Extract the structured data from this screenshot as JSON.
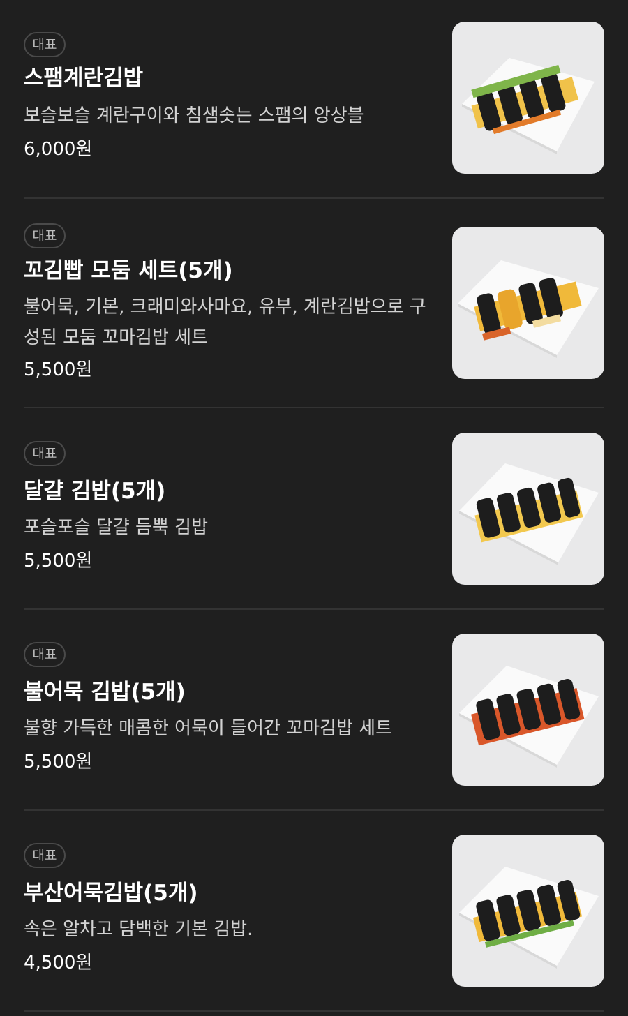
{
  "menu": {
    "items": [
      {
        "badge": "대표",
        "name": "스팸계란김밥",
        "desc": "보슬보슬 계란구이와 침샘솟는 스팸의 앙상블",
        "price": "6,000원",
        "image_icon": "gimbap-photo-icon"
      },
      {
        "badge": "대표",
        "name": "꼬김빱 모둠 세트(5개)",
        "desc": "불어묵, 기본, 크래미와사마요, 유부, 계란김밥으로 구성된 모둠 꼬마김밥 세트",
        "price": "5,500원",
        "image_icon": "gimbap-photo-icon"
      },
      {
        "badge": "대표",
        "name": "달걀 김밥(5개)",
        "desc": "포슬포슬 달걀 듬뿍 김밥",
        "price": "5,500원",
        "image_icon": "gimbap-photo-icon"
      },
      {
        "badge": "대표",
        "name": "불어묵 김밥(5개)",
        "desc": "불향 가득한 매콤한 어묵이 들어간 꼬마김밥 세트",
        "price": "5,500원",
        "image_icon": "gimbap-photo-icon"
      },
      {
        "badge": "대표",
        "name": "부산어묵김밥(5개)",
        "desc": "속은 알차고 담백한 기본 김밥.",
        "price": "4,500원",
        "image_icon": "gimbap-photo-icon"
      }
    ]
  },
  "colors": {
    "background": "#1f1f1f",
    "divider": "#333333",
    "badge_border": "#4a4a4a",
    "thumb_bg": "#e9e9ea"
  }
}
